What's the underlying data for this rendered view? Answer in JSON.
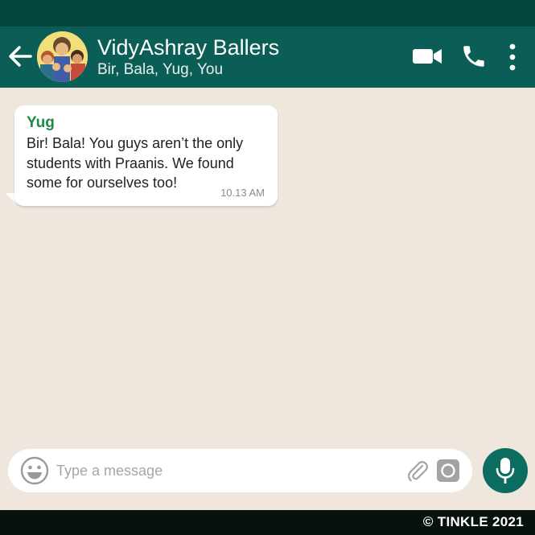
{
  "colors": {
    "status_bar": "#054740",
    "header": "#0b5e55",
    "chat_background": "#efe6dd",
    "sender_name": "#1f8a4a",
    "mic_button": "#0b6d5f",
    "footer": "#07120f"
  },
  "header": {
    "back_icon": "arrow-left-icon",
    "title": "VidyAshray Ballers",
    "subtitle": "Bir, Bala, Yug, You",
    "actions": [
      "video-call-icon",
      "phone-icon",
      "more-vertical-icon"
    ]
  },
  "messages": [
    {
      "sender": "Yug",
      "text": "Bir! Bala! You guys aren’t the only students with Praanis. We found some for ourselves too!",
      "time": "10.13 AM"
    }
  ],
  "composer": {
    "placeholder": "Type a message",
    "icons": [
      "emoji-icon",
      "paperclip-icon",
      "camera-icon",
      "microphone-icon"
    ]
  },
  "footer": {
    "copyright": "© TINKLE 2021"
  }
}
